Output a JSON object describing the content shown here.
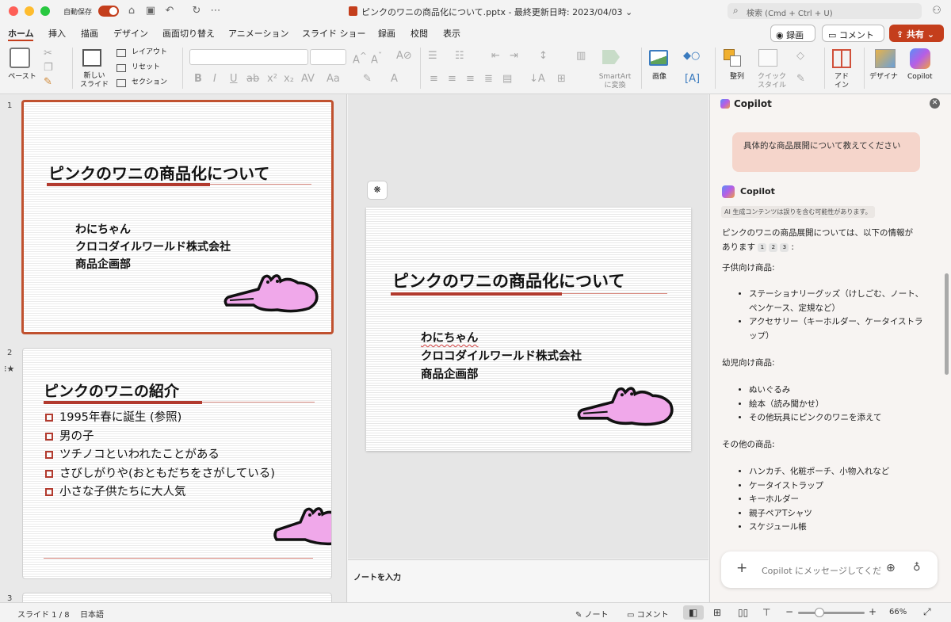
{
  "window": {
    "autosave_label": "自動保存",
    "doc_title": "ピンクのワニの商品化について.pptx - 最終更新日時: 2023/04/03 ⌄",
    "search_placeholder": "検索 (Cmd + Ctrl + U)"
  },
  "tabs": [
    "ホーム",
    "挿入",
    "描画",
    "デザイン",
    "画面切り替え",
    "アニメーション",
    "スライド ショー",
    "録画",
    "校閲",
    "表示"
  ],
  "header_buttons": {
    "record": "録画",
    "comment": "コメント",
    "share": "共有"
  },
  "ribbon": {
    "paste": "ペースト",
    "new_slide": "新しい\nスライド",
    "layout": "レイアウト",
    "reset": "リセット",
    "section": "セクション",
    "smartart": "SmartArt\nに変換",
    "picture": "画像",
    "arrange": "整列",
    "quick_style": "クイック\nスタイル",
    "addin": "アド\nイン",
    "designer": "デザイナ",
    "copilot": "Copilot"
  },
  "slides": [
    {
      "number": "1",
      "title": "ピンクのワニの商品化について",
      "body": [
        "わにちゃん",
        "クロコダイルワールド株式会社",
        "商品企画部"
      ]
    },
    {
      "number": "2",
      "title": "ピンクのワニの紹介",
      "bullets": [
        "1995年春に誕生 (参照)",
        "男の子",
        "ツチノコといわれたことがある",
        "さびしがりや(おともだちをさがしている)",
        "小さな子供たちに大人気"
      ]
    },
    {
      "number": "3"
    }
  ],
  "notes_placeholder": "ノートを入力",
  "copilot": {
    "header": "Copilot",
    "user_message": "具体的な商品展開について教えてください",
    "assistant_name": "Copilot",
    "ai_notice": "AI 生成コンテンツは誤りを含む可能性があります。",
    "intro_line1": "ピンクのワニの商品展開については、以下の情報が",
    "intro_line2": "あります",
    "refs": [
      "1",
      "2",
      "3"
    ],
    "sections": [
      {
        "heading": "子供向け商品:",
        "items": [
          "ステーショナリーグッズ（けしごむ、ノート、ペンケース、定規など）",
          "アクセサリー（キーホルダー、ケータイストラップ）"
        ]
      },
      {
        "heading": "幼児向け商品:",
        "items": [
          "ぬいぐるみ",
          "絵本（読み聞かせ）",
          "その他玩具にピンクのワニを添えて"
        ]
      },
      {
        "heading": "その他の商品:",
        "items": [
          "ハンカチ、化粧ポーチ、小物入れなど",
          "ケータイストラップ",
          "キーホルダー",
          "親子ペアTシャツ",
          "スケジュール帳"
        ]
      }
    ],
    "input_placeholder": "Copilot にメッセージしてくだ"
  },
  "status": {
    "slide_info": "スライド 1 / 8",
    "language": "日本語",
    "notes": "ノート",
    "comments": "コメント",
    "zoom": "66%"
  },
  "colors": {
    "accent": "#c43e1c",
    "croc_pink": "#f0a8ea",
    "title_bar_red": "#b23a2e"
  }
}
